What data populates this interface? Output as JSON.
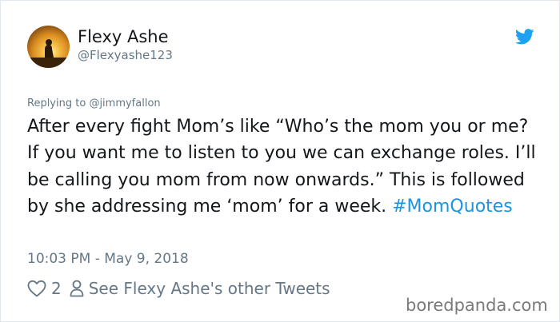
{
  "tweet": {
    "display_name": "Flexy Ashe",
    "handle": "@Flexyashe123",
    "replying_prefix": "Replying to ",
    "replying_to": "@jimmyfallon",
    "text": "After every fight Mom’s like “Who’s the mom you or me? If you want me to listen to you we can exchange roles. I’ll be calling you mom from now onwards.” This is followed by she addressing me ‘mom’ for a week. ",
    "hashtag": "#MomQuotes",
    "timestamp": "10:03 PM - May 9, 2018",
    "like_count": "2",
    "other_tweets_link": "See Flexy Ashe's other Tweets"
  },
  "icons": {
    "logo": "twitter-bird-icon",
    "like": "heart-icon",
    "profile": "person-icon"
  },
  "watermark": "boredpanda.com",
  "colors": {
    "twitter_blue": "#1da1f2",
    "hashtag": "#1b95e0",
    "secondary_text": "#657786",
    "primary_text": "#14171a",
    "border": "#e1e8ed"
  }
}
